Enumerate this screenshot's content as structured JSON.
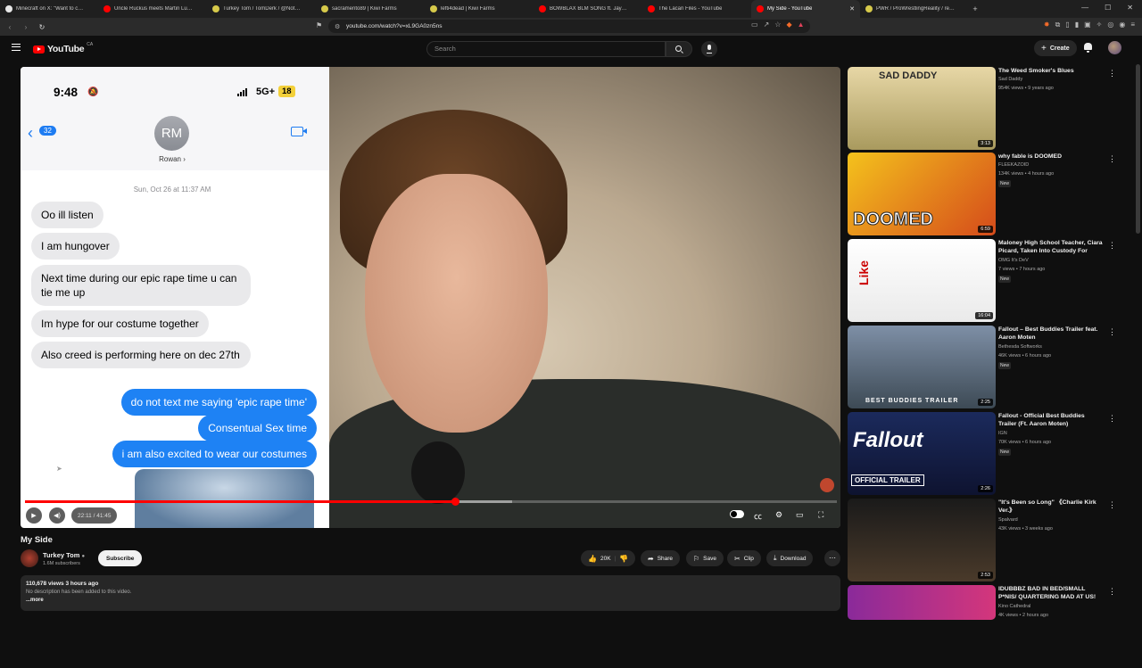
{
  "browser": {
    "tabs": [
      {
        "title": "Minecraft on X: \"Want to change the",
        "color": "#e8e8e8"
      },
      {
        "title": "Uncle Ruckus meets Martin Luther K",
        "color": "#ff0000"
      },
      {
        "title": "Turkey Tom / TomDerk / @NotATurk",
        "color": "#d6c94a"
      },
      {
        "title": "sacramento89 | Kiwi Farms",
        "color": "#d6c94a"
      },
      {
        "title": "lefti4dead | Kiwi Farms",
        "color": "#d6c94a"
      },
      {
        "title": "BOWBLAX BLM SONG ft. Jay Z, Emin",
        "color": "#ff0000"
      },
      {
        "title": "The Lacari Files - YouTube",
        "color": "#ff0000"
      },
      {
        "title": "My Side - YouTube",
        "color": "#ff0000"
      },
      {
        "title": "PWR / ProWrestlingReality / realpers",
        "color": "#d6c94a"
      }
    ],
    "url": "youtube.com/watch?v=xL9GA0zn5ns"
  },
  "header": {
    "logo_text": "YouTube",
    "country": "CA",
    "search_placeholder": "Search",
    "create_label": "Create"
  },
  "player": {
    "phone": {
      "time": "9:48",
      "network": "5G+",
      "battery": "18",
      "back_count": "32",
      "contact_initials": "RM",
      "contact_name": "Rowan",
      "timestamp": "Sun, Oct 26 at 11:37 AM",
      "messages_in": [
        "Oo ill listen",
        "I am hungover",
        "Next time during our epic rape time u can tie me up",
        "Im hype for our costume together",
        "Also creed is performing here on dec 27th"
      ],
      "messages_out": [
        "do not text me saying 'epic rape time'",
        "Consentual Sex time",
        "i am also excited to wear our costumes"
      ]
    },
    "time_display": "22:11 / 41:45",
    "progress_fraction": 0.53,
    "buffer_fraction": 0.6
  },
  "video": {
    "title": "My Side",
    "channel": "Turkey Tom",
    "subscribers": "1.6M subscribers",
    "subscribe_label": "Subscribe",
    "likes": "20K",
    "share_label": "Share",
    "save_label": "Save",
    "clip_label": "Clip",
    "download_label": "Download",
    "views_line": "110,678 views  3 hours ago",
    "description": "No description has been added to this video.",
    "more_label": "...more"
  },
  "recommendations": [
    {
      "title": "The Weed Smoker's Blues",
      "channel": "Sad Daddy",
      "views": "954K views • 9 years ago",
      "duration": "3:13",
      "new": "",
      "thumb_text": "SAD DADDY"
    },
    {
      "title": "why fable is DOOMED",
      "channel": "FLEEKAZOID",
      "views": "134K views • 4 hours ago",
      "duration": "6:59",
      "new": "New",
      "thumb_text": "DOOMED"
    },
    {
      "title": "Maloney High School Teacher, Ciara Picard, Taken Into Custody For Doin...",
      "channel": "OMG It's DeV",
      "views": "7 views • 7 hours ago",
      "duration": "16:04",
      "new": "New",
      "thumb_text": "Like"
    },
    {
      "title": "Fallout – Best Buddies Trailer feat. Aaron Moten",
      "channel": "Bethesda Softworks",
      "views": "46K views • 6 hours ago",
      "duration": "2:25",
      "new": "New",
      "thumb_text": "BEST BUDDIES TRAILER"
    },
    {
      "title": "Fallout - Official Best Buddies Trailer (Ft. Aaron Moten)",
      "channel": "IGN",
      "views": "70K views • 6 hours ago",
      "duration": "2:26",
      "new": "New",
      "thumb_text": "OFFICIAL TRAILER"
    },
    {
      "title": "\"It's Been so Long\" 《Charlie Kirk Ver.》",
      "channel": "Spalvard",
      "views": "43K views • 3 weeks ago",
      "duration": "2:53",
      "new": "",
      "thumb_text": ""
    },
    {
      "title": "IDUBBBZ BAD IN BED/SMALL P*NIS/ QUARTERING MAD AT US! BAKED ...",
      "channel": "Kino Cathedral",
      "views": "4K views • 2 hours ago",
      "duration": "",
      "new": "",
      "thumb_text": ""
    }
  ]
}
